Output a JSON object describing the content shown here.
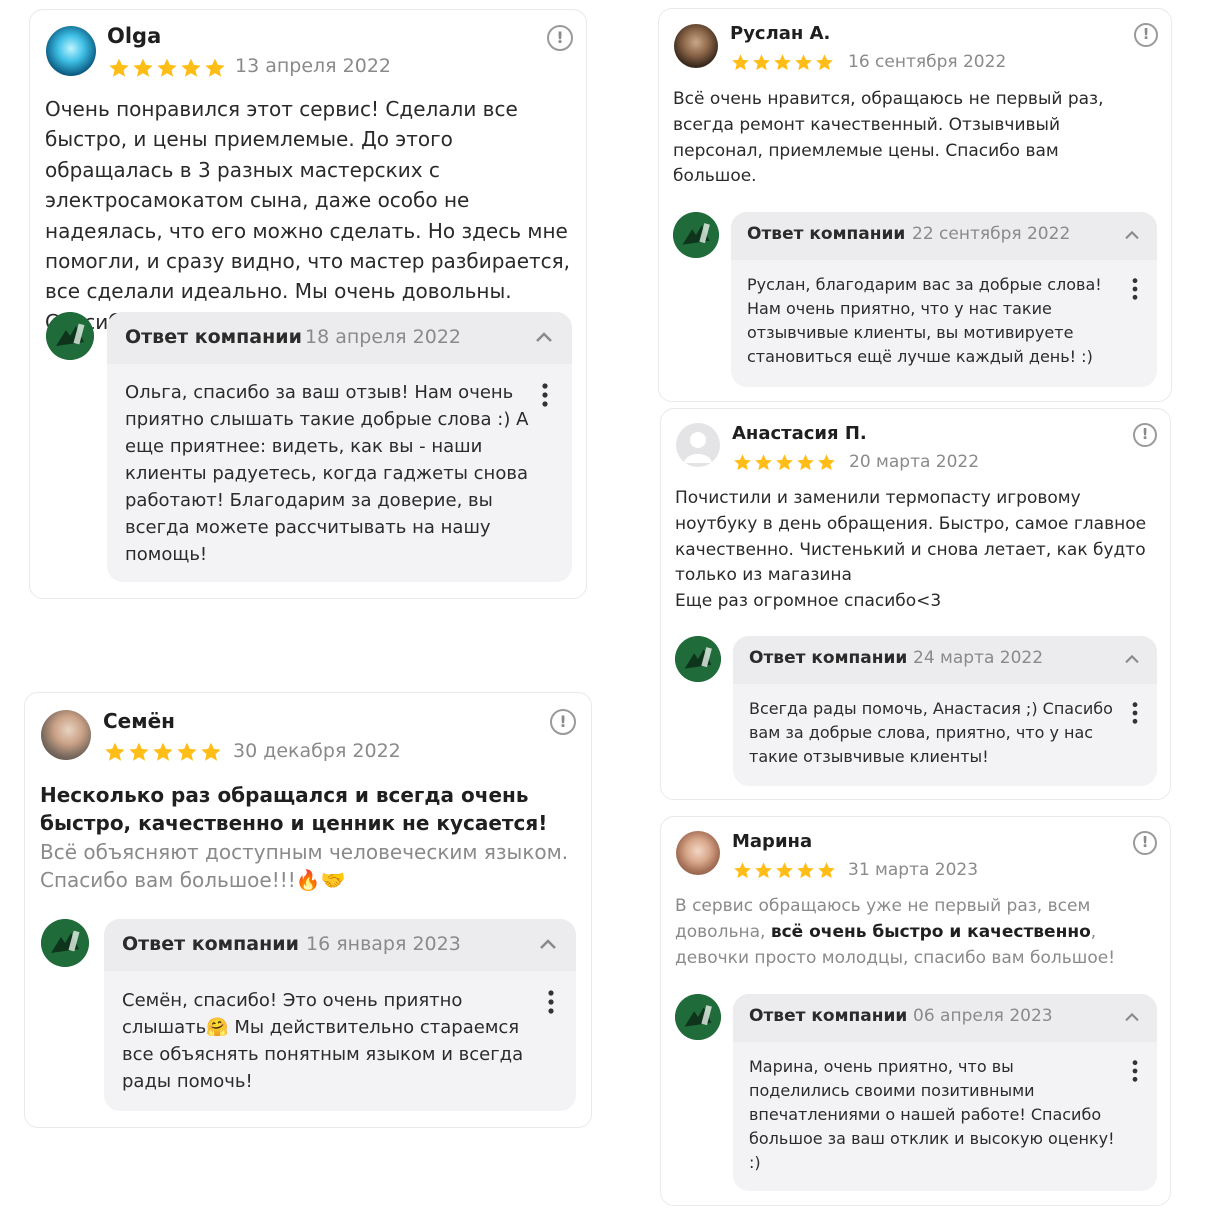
{
  "colors": {
    "accent": "#ffbe17",
    "answer_bg": "#f3f3f5",
    "logo": "#1f6b3a"
  },
  "icons": {
    "star": "star-icon",
    "warn": "exclamation-circle-icon",
    "chevron": "chevron-up-icon",
    "menu": "vertical-dots-icon"
  },
  "reviews": [
    {
      "name": "Olga",
      "date": "13 апреля 2022",
      "rating": 5,
      "text": "Очень понравился этот сервис! Сделали все быстро, и цены приемлемые. До этого обращалась в 3 разных мастерских с электросамокатом сына, даже особо не надеялась, что его можно сделать. Но здесь мне помогли, и сразу видно, что мастер разбирается, все сделали идеально. Мы очень довольны. Спасибо!",
      "reply_label": "Ответ компании",
      "reply_date": "18 апреля 2022",
      "reply_text": "Ольга, спасибо за ваш отзыв! Нам очень приятно слышать такие добрые слова :) А еще приятнее: видеть, как вы - наши клиенты радуетесь, когда гаджеты снова работают! Благодарим за доверие, вы всегда можете рассчитывать на нашу помощь!"
    },
    {
      "name": "Семён",
      "date": "30 декабря 2022",
      "rating": 5,
      "text_bold": "Несколько раз обращался и всегда очень быстро, качественно и ценник не кусается!",
      "text_rest": " Всё объясняют доступным человеческим языком. Спасибо вам большое!!!🔥🤝",
      "reply_label": "Ответ компании",
      "reply_date": "16 января 2023",
      "reply_text": "Семён, спасибо! Это очень приятно слышать🤗 Мы действительно стараемся все объяснять понятным языком и всегда рады помочь!"
    },
    {
      "name": "Руслан А.",
      "date": "16 сентября 2022",
      "rating": 5,
      "text": "Всё очень нравится, обращаюсь не первый раз, всегда ремонт качественный. Отзывчивый персонал, приемлемые цены. Спасибо вам большое.",
      "reply_label": "Ответ компании",
      "reply_date": "22 сентября 2022",
      "reply_text": "Руслан, благодарим вас за добрые слова! Нам очень приятно, что у нас такие отзывчивые клиенты, вы мотивируете становиться ещё лучше каждый день! :)"
    },
    {
      "name": "Анастасия П.",
      "date": "20 марта 2022",
      "rating": 5,
      "text": "Почистили и заменили термопасту игровому ноутбуку в день обращения. Быстро, самое главное качественно. Чистенький и снова летает, как будто только из магазина",
      "text2": "Еще раз огромное спасибо<3",
      "reply_label": "Ответ компании",
      "reply_date": "24 марта 2022",
      "reply_text": "Всегда рады помочь, Анастасия ;) Спасибо вам за добрые слова, приятно, что у нас такие отзывчивые клиенты!"
    },
    {
      "name": "Марина",
      "date": "31 марта 2023",
      "rating": 5,
      "text_a": "В сервис обращаюсь уже не первый раз, всем довольна, ",
      "text_b": "всё очень быстро и качественно",
      "text_c": ", девочки просто молодцы, спасибо вам большое!",
      "reply_label": "Ответ компании",
      "reply_date": "06 апреля 2023",
      "reply_text": "Марина, очень приятно, что вы поделились своими позитивными впечатлениями о нашей работе! Спасибо большое за ваш отклик и высокую оценку! :)"
    }
  ]
}
